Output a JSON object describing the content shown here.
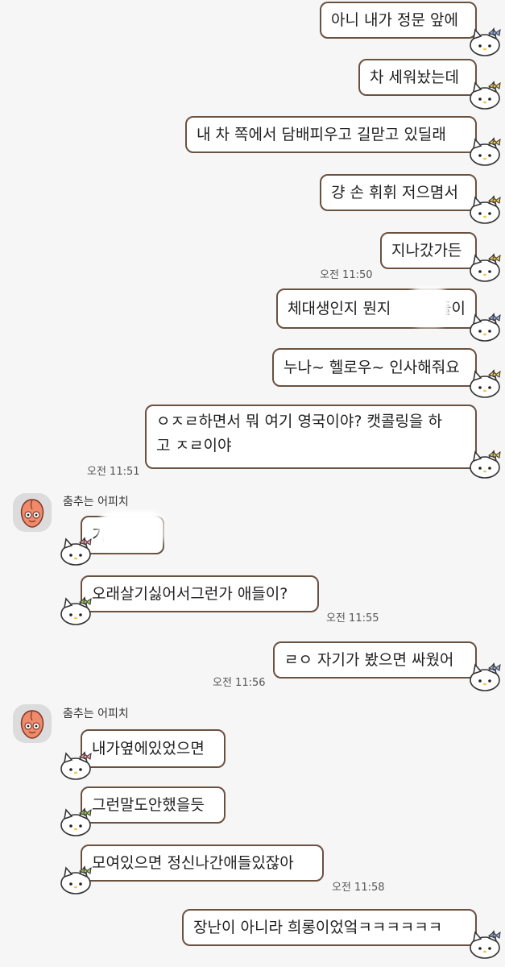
{
  "colors": {
    "background": "#f6f6f6",
    "bubble_border": "#6b5140",
    "bubble_fill": "#ffffff",
    "peach": "#f08a6a",
    "bow_blue": "#8ea8e0",
    "bow_yellow": "#f3c64a",
    "bow_green": "#9cc35a",
    "bow_pink": "#f29aa8"
  },
  "messages": [
    {
      "from": "me",
      "text": "아니 내가 정문 앞에",
      "bow": "blue"
    },
    {
      "from": "me",
      "text": "차 세워놨는데",
      "bow": "yellow"
    },
    {
      "from": "me",
      "text": "내 차 쪽에서 담배피우고 길맏고 있딜래",
      "bow": "yellow"
    },
    {
      "from": "me",
      "text": "걍 손 휘휘 저으몀서",
      "bow": "yellow"
    },
    {
      "from": "me",
      "text": "지나갔가든",
      "bow": "yellow",
      "time": "오전 11:50"
    },
    {
      "from": "me",
      "text": "체대생인지 뭔지",
      "text_after": "들이",
      "bow": "blue"
    },
    {
      "from": "me",
      "text": "누나~ 헬로우~ 인사해줘요",
      "bow": "yellow"
    },
    {
      "from": "me",
      "line1": "ㅇㅈㄹ하면서 뭐 여기 영국이야? 캣콜링을 하",
      "line2": "고 ㅈㄹ이야",
      "bow": "yellow",
      "time": "오전 11:51"
    },
    {
      "from": "peach",
      "sender": "춤추는 어피치",
      "text": "기",
      "bow": "pink"
    },
    {
      "from": "peach",
      "text": "오래살기싫어서그런가 애들이?",
      "bow": "green",
      "time": "오전 11:55"
    },
    {
      "from": "me",
      "text": "ㄹㅇ 자기가 봤으면 싸웠어",
      "bow": "blue",
      "time": "오전 11:56"
    },
    {
      "from": "peach",
      "sender": "춤추는 어피치",
      "text": "내가옆에있었으면",
      "bow": "pink"
    },
    {
      "from": "peach",
      "text": "그런말도안했을듯",
      "bow": "green"
    },
    {
      "from": "peach",
      "text": "모여있으면 정신나간애들있잖아",
      "bow": "green",
      "time": "오전 11:58"
    },
    {
      "from": "me",
      "text": "장난이 아니라 희롱이었엌ㅋㅋㅋㅋㅋㅋ",
      "bow": "blue"
    }
  ]
}
